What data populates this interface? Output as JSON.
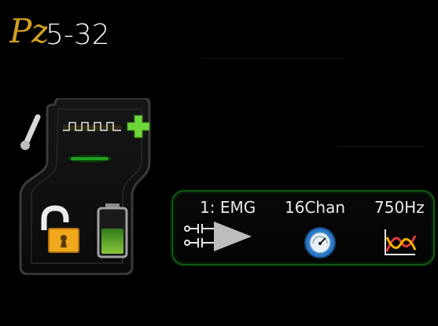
{
  "brand": {
    "logo_text": "Pz",
    "model": "5-32"
  },
  "device": {
    "status": "unlocked",
    "battery_level": 0.55,
    "link_active": true,
    "accent_color": "#6fd63a",
    "lock_color": "#f0a81c"
  },
  "channel": {
    "name": "1: EMG",
    "count": "16Chan",
    "rate": "750Hz",
    "icons": [
      "amplifier-icon",
      "gauge-icon",
      "waveform-filter-icon"
    ]
  }
}
